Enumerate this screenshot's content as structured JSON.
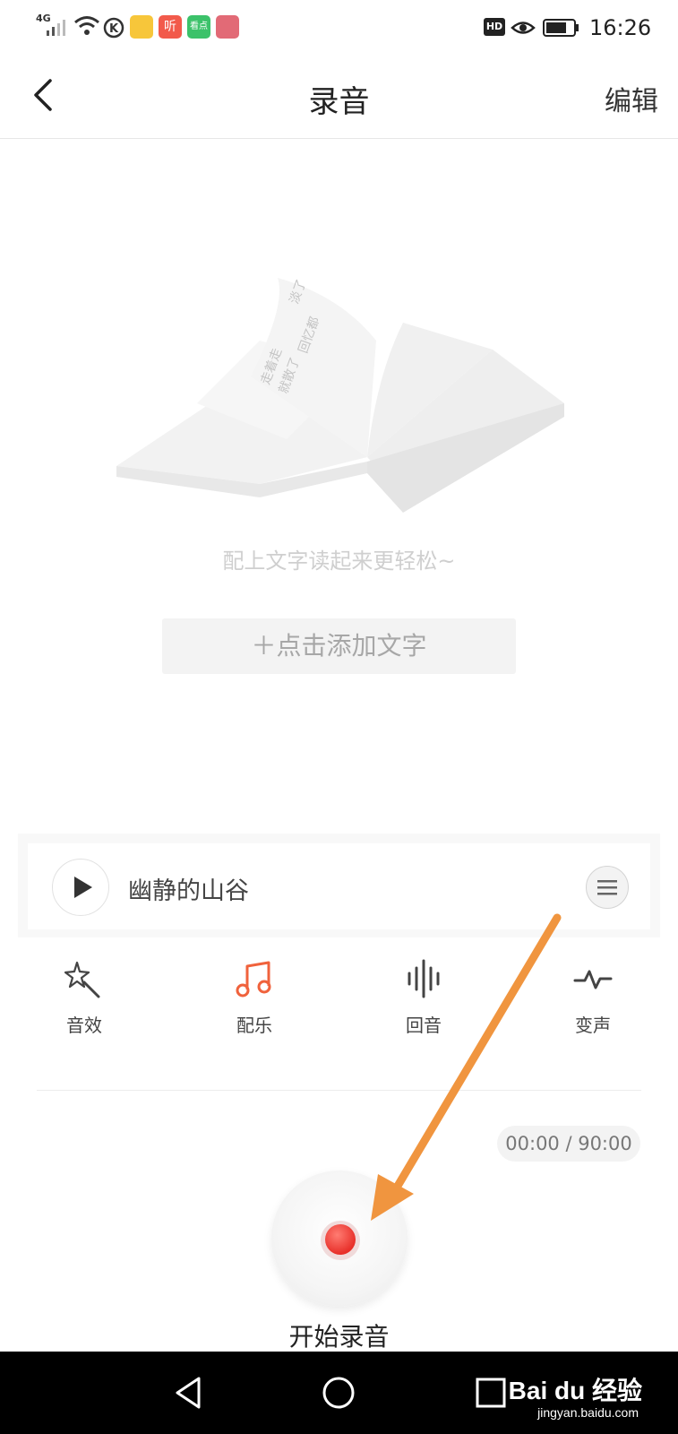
{
  "status_bar": {
    "network": "4G",
    "time": "16:26",
    "hd_badge": "HD",
    "app_icon_ting": "听",
    "app_icon_kandian": "看点"
  },
  "nav": {
    "title": "录音",
    "edit_label": "编辑",
    "back_icon": "chevron-left-icon"
  },
  "illustration": {
    "book_text": [
      "走着走",
      "就散了",
      "回忆都",
      "淡了"
    ]
  },
  "hint_text": "配上文字读起来更轻松~",
  "add_text_button": "＋点击添加文字",
  "music": {
    "song_title": "幽静的山谷",
    "play_icon": "play-icon",
    "menu_icon": "menu-icon"
  },
  "tools": [
    {
      "label": "音效",
      "icon": "magic-wand-icon",
      "active": false
    },
    {
      "label": "配乐",
      "icon": "music-note-icon",
      "active": true
    },
    {
      "label": "回音",
      "icon": "waveform-icon",
      "active": false
    },
    {
      "label": "变声",
      "icon": "pulse-icon",
      "active": false
    }
  ],
  "timer": "00:00 / 90:00",
  "record_label": "开始录音",
  "watermark": {
    "brand": "Bai du 经验",
    "url": "jingyan.baidu.com"
  },
  "colors": {
    "accent": "#f0623c",
    "record_red": "#e8302a",
    "arrow": "#f0953f"
  }
}
